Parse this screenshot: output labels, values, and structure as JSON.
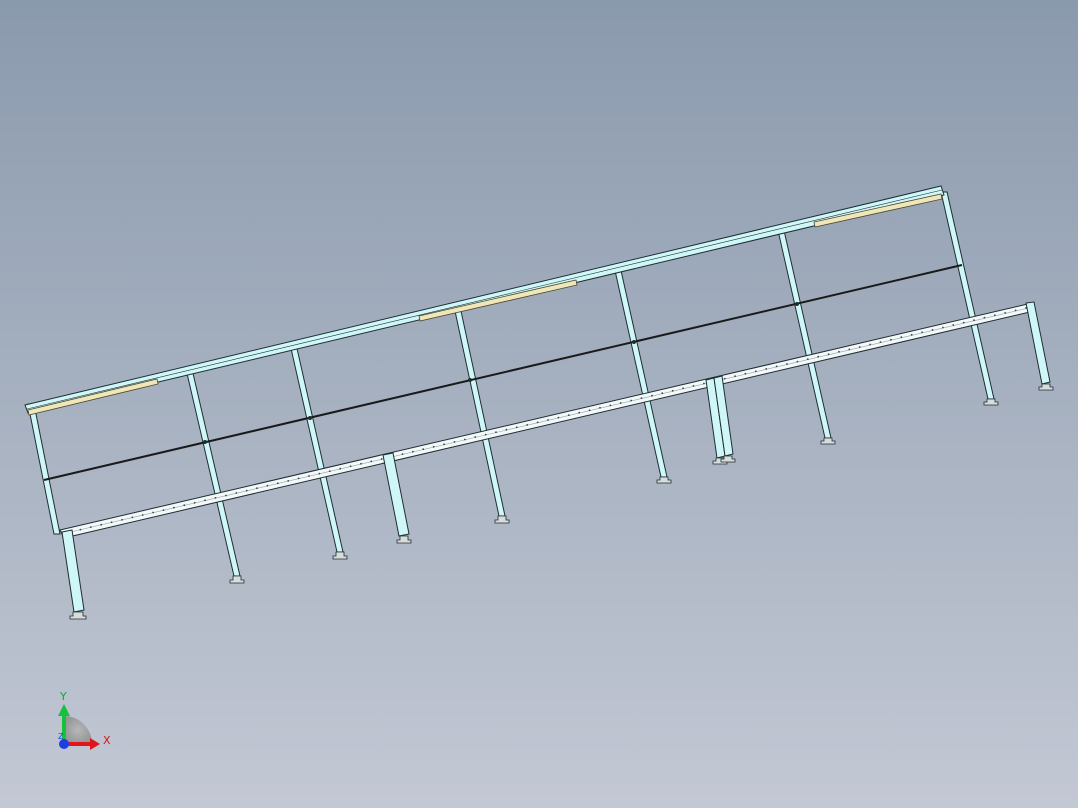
{
  "viewport": {
    "background_top": "#8a9aad",
    "background_bottom": "#c3c8d4"
  },
  "model": {
    "frame_fill": "#cff7f7",
    "frame_edge": "#1f2d33",
    "rail_fill": "#f4f8f8",
    "light_fill": "#efe7b8",
    "wire_color": "#1a1a1a"
  },
  "triad": {
    "x_label": "X",
    "y_label": "Y",
    "z_label": "Z",
    "x_color": "#e0161b",
    "y_color": "#16c23b",
    "z_color": "#1d3fe0"
  }
}
